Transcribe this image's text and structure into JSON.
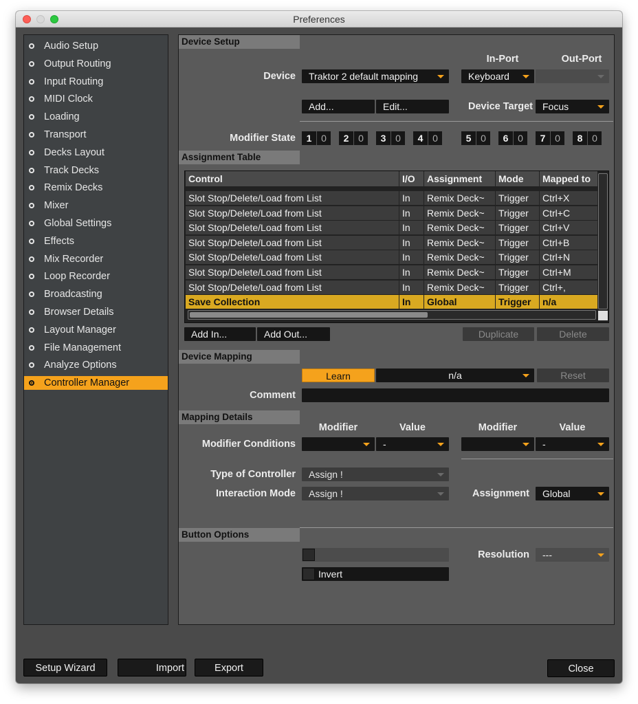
{
  "window": {
    "title": "Preferences"
  },
  "sidebar": {
    "items": [
      {
        "label": "Audio Setup"
      },
      {
        "label": "Output Routing"
      },
      {
        "label": "Input Routing"
      },
      {
        "label": "MIDI Clock"
      },
      {
        "label": "Loading"
      },
      {
        "label": "Transport"
      },
      {
        "label": "Decks Layout"
      },
      {
        "label": "Track Decks"
      },
      {
        "label": "Remix Decks"
      },
      {
        "label": "Mixer"
      },
      {
        "label": "Global Settings"
      },
      {
        "label": "Effects"
      },
      {
        "label": "Mix Recorder"
      },
      {
        "label": "Loop Recorder"
      },
      {
        "label": "Broadcasting"
      },
      {
        "label": "Browser Details"
      },
      {
        "label": "Layout Manager"
      },
      {
        "label": "File Management"
      },
      {
        "label": "Analyze Options"
      },
      {
        "label": "Controller Manager"
      }
    ],
    "active_index": 19
  },
  "device_setup": {
    "heading": "Device Setup",
    "in_port_label": "In-Port",
    "out_port_label": "Out-Port",
    "device_label": "Device",
    "device_value": "Traktor 2 default mapping",
    "in_port_value": "Keyboard",
    "out_port_value": "",
    "add_button": "Add...",
    "edit_button": "Edit...",
    "device_target_label": "Device Target",
    "device_target_value": "Focus",
    "modifier_state_label": "Modifier State",
    "modifiers": [
      {
        "n": "1",
        "v": "0"
      },
      {
        "n": "2",
        "v": "0"
      },
      {
        "n": "3",
        "v": "0"
      },
      {
        "n": "4",
        "v": "0"
      },
      {
        "n": "5",
        "v": "0"
      },
      {
        "n": "6",
        "v": "0"
      },
      {
        "n": "7",
        "v": "0"
      },
      {
        "n": "8",
        "v": "0"
      }
    ]
  },
  "assignment_table": {
    "heading": "Assignment Table",
    "columns": [
      "Control",
      "I/O",
      "Assignment",
      "Mode",
      "Mapped to"
    ],
    "rows": [
      {
        "control": "Slot Stop/Delete/Load from List",
        "io": "In",
        "assignment": "Remix Deck~",
        "mode": "Trigger",
        "mapped": "Ctrl+X"
      },
      {
        "control": "Slot Stop/Delete/Load from List",
        "io": "In",
        "assignment": "Remix Deck~",
        "mode": "Trigger",
        "mapped": "Ctrl+C"
      },
      {
        "control": "Slot Stop/Delete/Load from List",
        "io": "In",
        "assignment": "Remix Deck~",
        "mode": "Trigger",
        "mapped": "Ctrl+V"
      },
      {
        "control": "Slot Stop/Delete/Load from List",
        "io": "In",
        "assignment": "Remix Deck~",
        "mode": "Trigger",
        "mapped": "Ctrl+B"
      },
      {
        "control": "Slot Stop/Delete/Load from List",
        "io": "In",
        "assignment": "Remix Deck~",
        "mode": "Trigger",
        "mapped": "Ctrl+N"
      },
      {
        "control": "Slot Stop/Delete/Load from List",
        "io": "In",
        "assignment": "Remix Deck~",
        "mode": "Trigger",
        "mapped": "Ctrl+M"
      },
      {
        "control": "Slot Stop/Delete/Load from List",
        "io": "In",
        "assignment": "Remix Deck~",
        "mode": "Trigger",
        "mapped": "Ctrl+,"
      },
      {
        "control": "Save Collection",
        "io": "In",
        "assignment": "Global",
        "mode": "Trigger",
        "mapped": "n/a"
      }
    ],
    "selected_index": 7,
    "add_in_button": "Add In...",
    "add_out_button": "Add Out...",
    "duplicate_button": "Duplicate",
    "delete_button": "Delete"
  },
  "device_mapping": {
    "heading": "Device Mapping",
    "learn_button": "Learn",
    "mapping_value": "n/a",
    "reset_button": "Reset",
    "comment_label": "Comment",
    "comment_value": ""
  },
  "mapping_details": {
    "heading": "Mapping Details",
    "modifier_label": "Modifier",
    "value_label": "Value",
    "modifier_conditions_label": "Modifier Conditions",
    "cond1_modifier": "",
    "cond1_value": "-",
    "cond2_modifier": "",
    "cond2_value": "-",
    "type_of_controller_label": "Type of Controller",
    "type_of_controller_value": "Assign !",
    "interaction_mode_label": "Interaction Mode",
    "interaction_mode_value": "Assign !",
    "assignment_label": "Assignment",
    "assignment_value": "Global"
  },
  "button_options": {
    "heading": "Button Options",
    "resolution_label": "Resolution",
    "resolution_value": "---",
    "invert_label": "Invert"
  },
  "footer": {
    "setup_wizard": "Setup Wizard",
    "import": "Import",
    "export": "Export",
    "close": "Close"
  },
  "colors": {
    "accent": "#f5a21c",
    "selected_row": "#d9a921",
    "panel": "#5a5a5a",
    "sidebar": "#3f4244"
  }
}
